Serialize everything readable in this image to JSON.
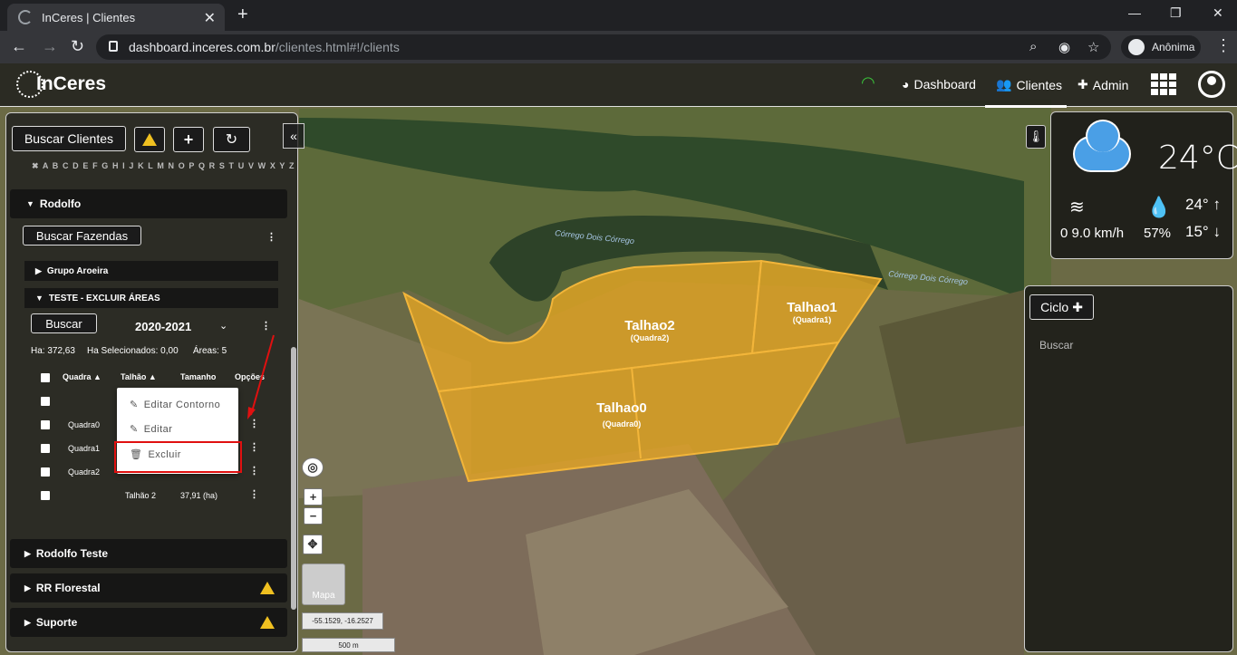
{
  "browser": {
    "tab_title": "InCeres | Clientes",
    "url_host": "dashboard.inceres.com.br",
    "url_path": "/clientes.html#!/clients",
    "profile_label": "Anônima"
  },
  "app": {
    "logo": "InCeres",
    "nav": {
      "dashboard": "Dashboard",
      "clientes": "Clientes",
      "admin": "Admin"
    }
  },
  "panel": {
    "search_clients": "Buscar Clientes",
    "alphabet": "✖ A B C D E F G H I J K L M N O P Q R S T U V W X Y Z",
    "client_open": "Rodolfo",
    "search_farms": "Buscar Fazendas",
    "farm_group": "Grupo Aroeira",
    "farm_open": "TESTE - EXCLUIR ÁREAS",
    "search_btn": "Buscar",
    "season": "2020-2021",
    "ha_total": "Ha: 372,63",
    "ha_selected": "Ha Selecionados: 0,00",
    "areas": "Áreas: 5",
    "table": {
      "headers": {
        "quadra": "Quadra",
        "talhao": "Talhão",
        "tamanho": "Tamanho",
        "opcoes": "Opções"
      },
      "rows": [
        {
          "quadra": "",
          "talhao": "",
          "tamanho": ""
        },
        {
          "quadra": "Quadra0",
          "talhao": "",
          "tamanho": ""
        },
        {
          "quadra": "Quadra1",
          "talhao": "",
          "tamanho": ""
        },
        {
          "quadra": "Quadra2",
          "talhao": "",
          "tamanho": ""
        },
        {
          "quadra": "",
          "talhao": "Talhão 2",
          "tamanho": "37,91 (ha)"
        }
      ]
    },
    "other_clients": [
      "Rodolfo Teste",
      "RR Florestal",
      "Suporte"
    ]
  },
  "context_menu": {
    "edit_contour": "Editar Contorno",
    "edit": "Editar",
    "delete": "Excluir"
  },
  "map": {
    "creek_labels": [
      "Córrego Dois Córrego",
      "Córrego Dois Córrego"
    ],
    "fields": [
      {
        "name": "Talhao2",
        "sub": "(Quadra2)"
      },
      {
        "name": "Talhao1",
        "sub": "(Quadra1)"
      },
      {
        "name": "Talhao0",
        "sub": "(Quadra0)"
      }
    ],
    "thumb_label": "Mapa",
    "coords": "-55.1529, -16.2527",
    "scale": "500 m"
  },
  "weather": {
    "temp": "24°C",
    "max": "24°",
    "min": "15°",
    "wind": "0 9.0 km/h",
    "humidity": "57%"
  },
  "ciclo": {
    "button": "Ciclo",
    "search": "Buscar"
  },
  "colors": {
    "field_fill": "#e8a623",
    "highlight": "#e01010",
    "warning": "#f0c020"
  }
}
